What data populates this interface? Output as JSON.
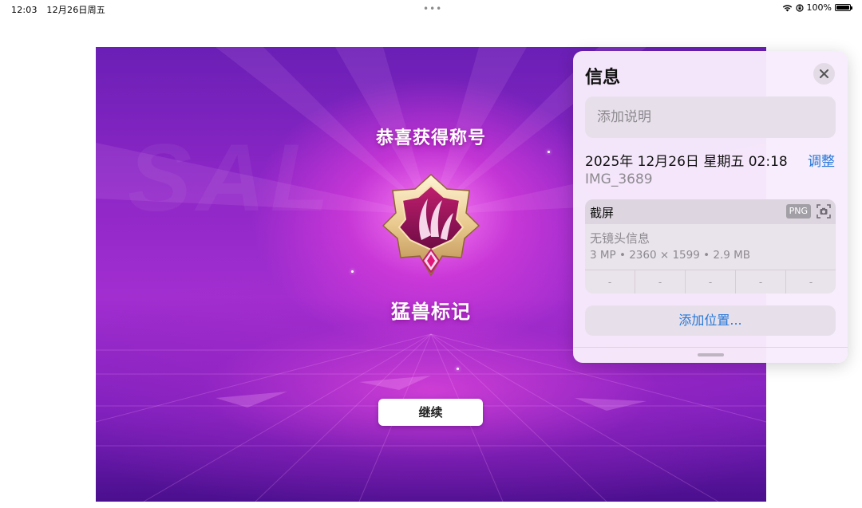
{
  "status_bar": {
    "time": "12:03",
    "date": "12月26日周五",
    "dots": "•••",
    "battery_text": "100%",
    "battery_level": 1.0
  },
  "game": {
    "bg_text": "SAL",
    "title": "恭喜获得称号",
    "subtitle": "猛兽标记",
    "continue_label": "继续",
    "colors": {
      "primary": "#8d26c6",
      "glow": "#ff82f5"
    }
  },
  "info_panel": {
    "title": "信息",
    "caption_placeholder": "添加说明",
    "date": "2025年 12月26日 星期五 02:18",
    "adjust_label": "调整",
    "filename": "IMG_3689",
    "meta": {
      "type": "截屏",
      "format_badge": "PNG",
      "lens": "无镜头信息",
      "spec": "3 MP • 2360 × 1599 • 2.9 MB",
      "cells": [
        "-",
        "-",
        "-",
        "-",
        "-"
      ]
    },
    "add_location_label": "添加位置...",
    "accent": "#2577d8"
  }
}
